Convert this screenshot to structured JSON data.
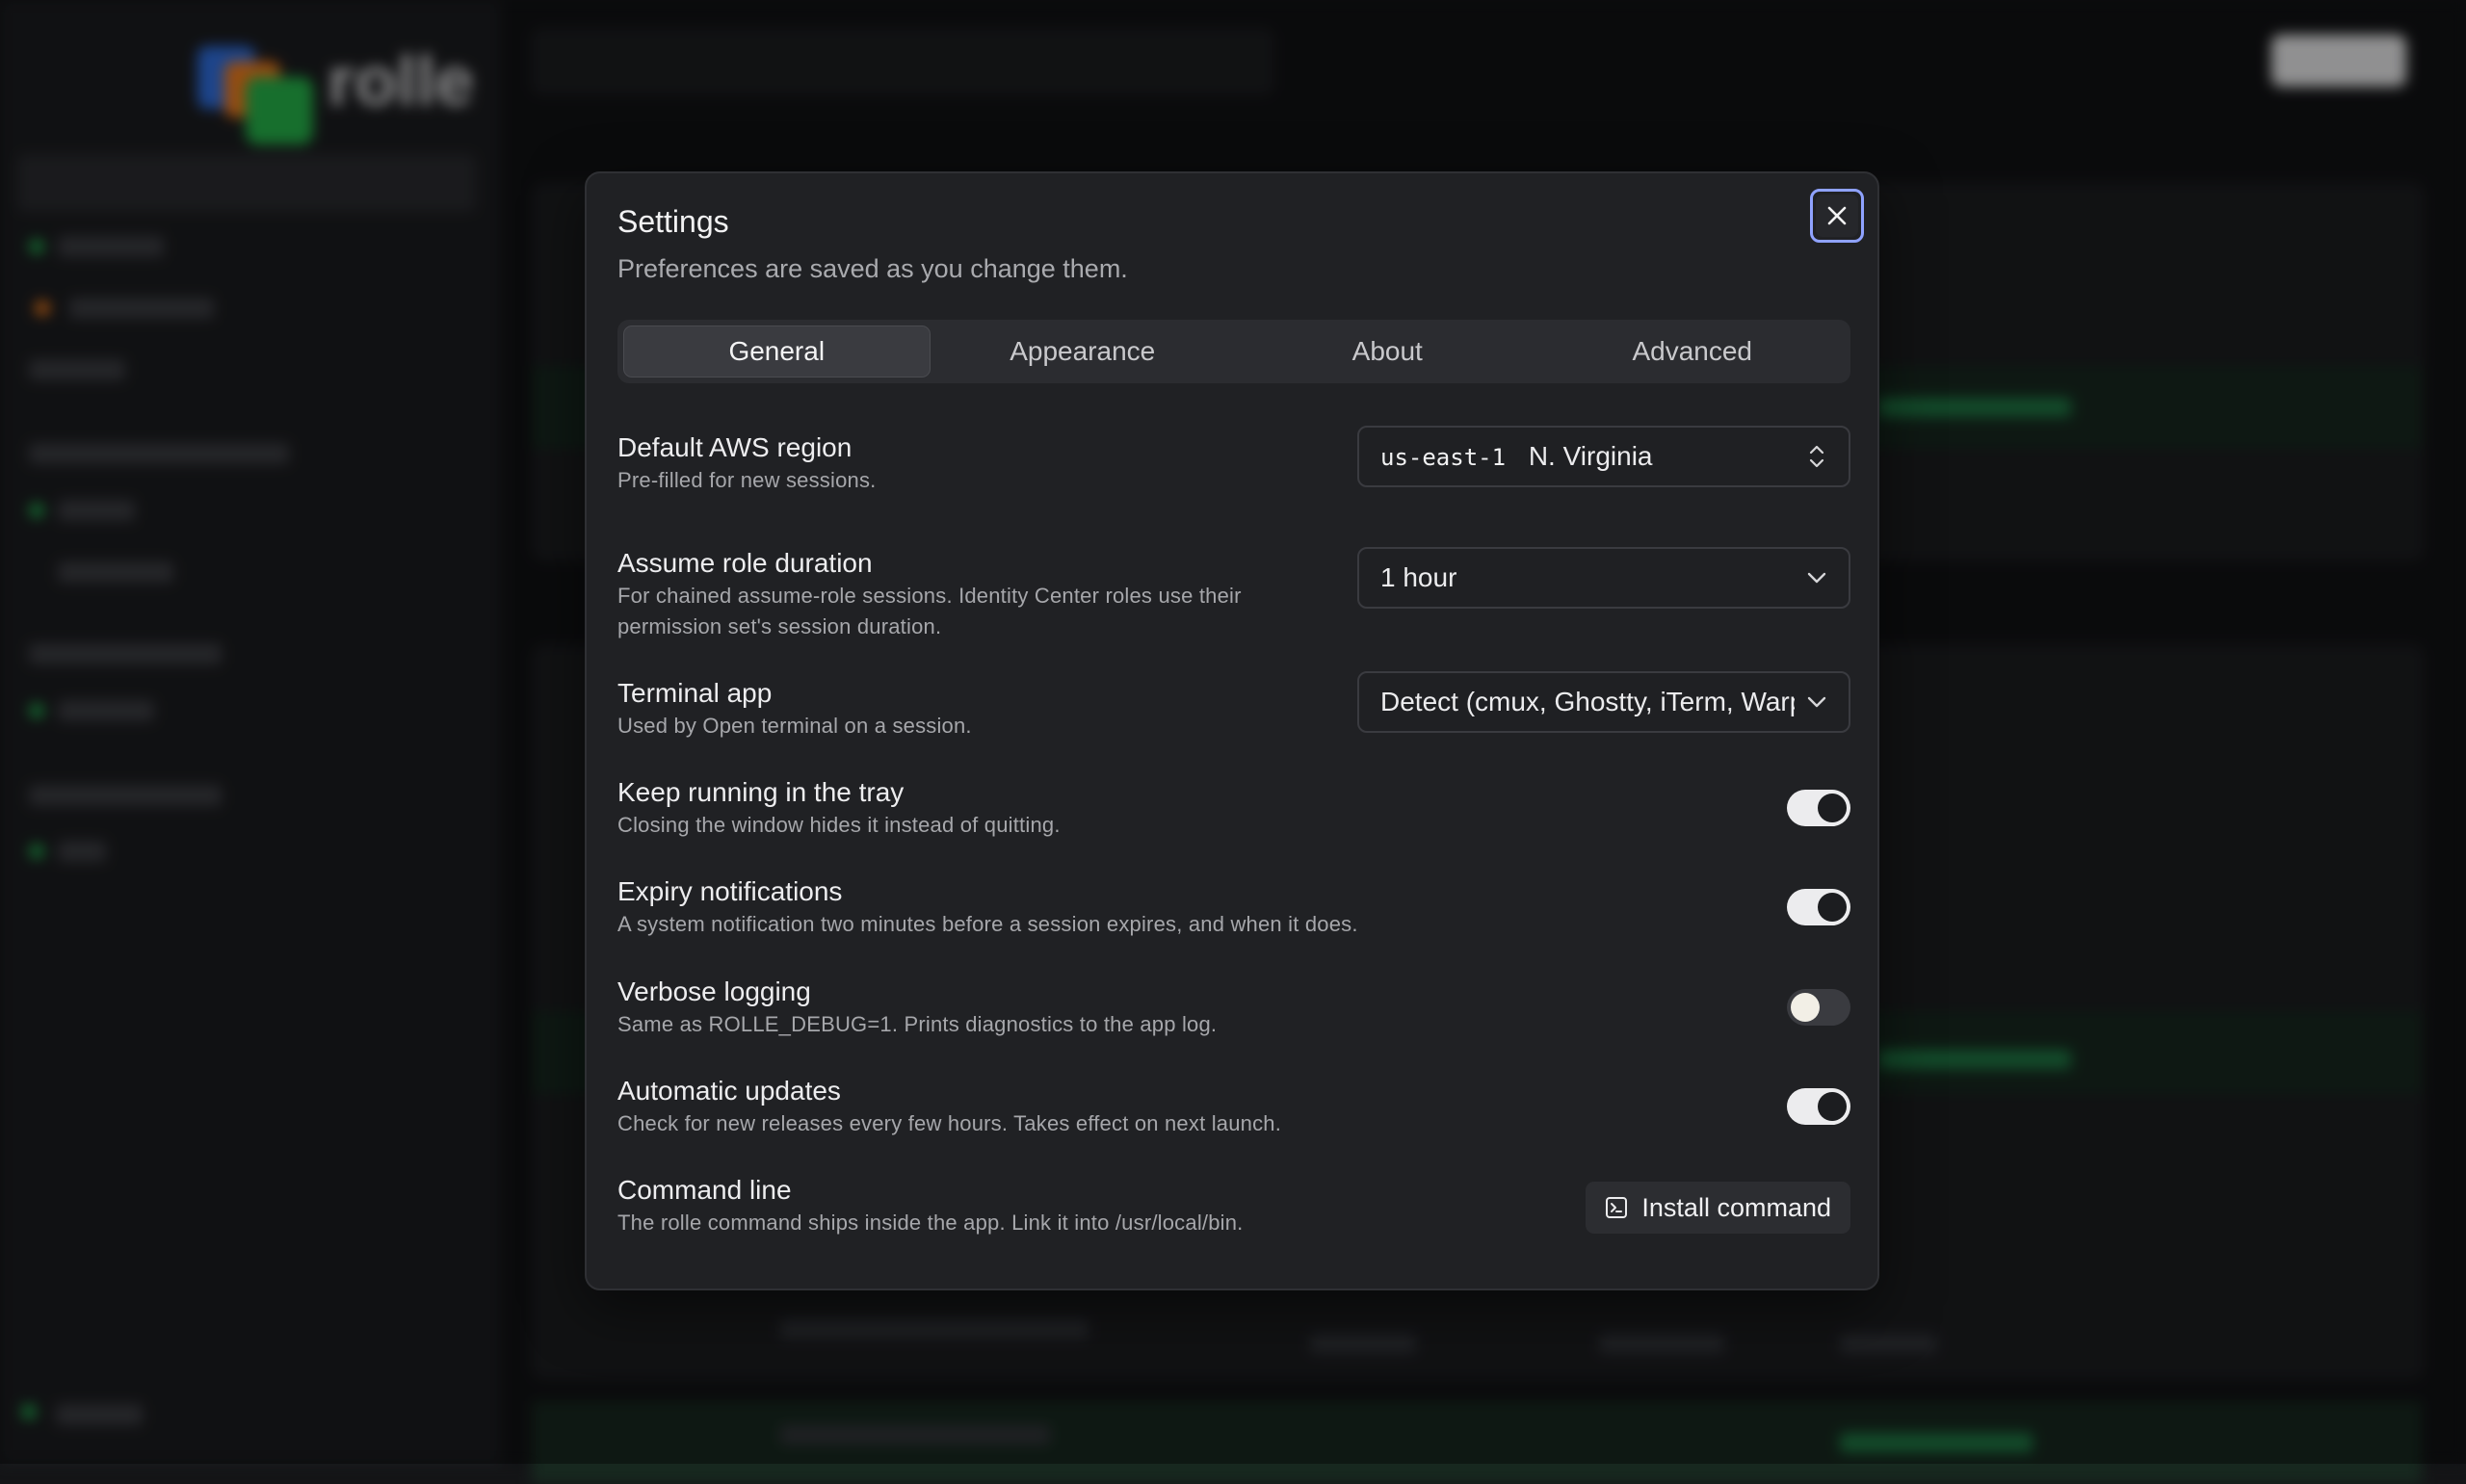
{
  "dialog": {
    "title": "Settings",
    "subtitle": "Preferences are saved as you change them.",
    "close_icon": "close-icon"
  },
  "tabs": [
    {
      "label": "General",
      "active": true
    },
    {
      "label": "Appearance",
      "active": false
    },
    {
      "label": "About",
      "active": false
    },
    {
      "label": "Advanced",
      "active": false
    }
  ],
  "settings": {
    "region": {
      "label": "Default AWS region",
      "desc": "Pre-filled for new sessions.",
      "code": "us-east-1",
      "name": "N. Virginia",
      "icon": "chevron-up-down-icon"
    },
    "duration": {
      "label": "Assume role duration",
      "desc_line1": "For chained assume-role sessions. Identity Center roles use their",
      "desc_line2": "permission set's session duration.",
      "value": "1 hour",
      "icon": "chevron-down-icon"
    },
    "terminal": {
      "label": "Terminal app",
      "desc": "Used by Open terminal on a session.",
      "value": "Detect (cmux, Ghostty, iTerm, Warp, Terminal)",
      "icon": "chevron-down-icon"
    },
    "tray": {
      "label": "Keep running in the tray",
      "desc": "Closing the window hides it instead of quitting.",
      "on": true
    },
    "expiry": {
      "label": "Expiry notifications",
      "desc": "A system notification two minutes before a session expires, and when it does.",
      "on": true
    },
    "verbose": {
      "label": "Verbose logging",
      "desc": "Same as ROLLE_DEBUG=1. Prints diagnostics to the app log.",
      "on": false
    },
    "updates": {
      "label": "Automatic updates",
      "desc": "Check for new releases every few hours. Takes effect on next launch.",
      "on": true
    },
    "cli": {
      "label": "Command line",
      "desc": "The rolle command ships inside the app. Link it into /usr/local/bin.",
      "button": "Install command",
      "icon": "terminal-icon"
    }
  },
  "background": {
    "logo_text": "rolle"
  }
}
